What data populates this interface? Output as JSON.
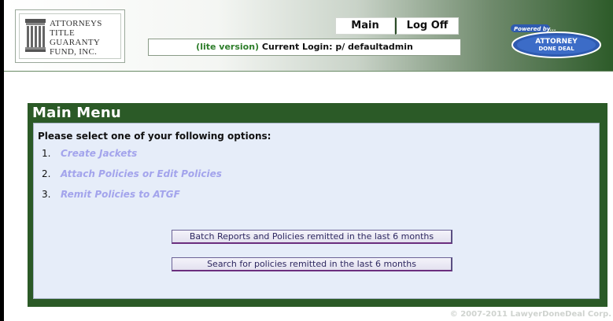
{
  "header": {
    "logo": {
      "lines": [
        "Attorneys",
        "Title",
        "Guaranty",
        "Fund, Inc."
      ]
    },
    "nav": {
      "main_label": "Main",
      "logoff_label": "Log Off"
    },
    "login": {
      "lite_label": "(lite version)",
      "current_login_text": "Current Login: p/ defaultadmin"
    },
    "powered_badge": {
      "top_text": "Powered by...",
      "brand_line1": "ATTORNEY",
      "brand_line2": "DONE DEAL"
    }
  },
  "main_menu": {
    "title": "Main Menu",
    "prompt": "Please select one of your following options:",
    "options": [
      {
        "number": "1.",
        "label": "Create Jackets"
      },
      {
        "number": "2.",
        "label": "Attach Policies or Edit Policies"
      },
      {
        "number": "3.",
        "label": "Remit Policies to ATGF"
      }
    ],
    "buttons": {
      "batch_reports": "Batch Reports and Policies remitted in the last 6 months",
      "search_policies": "Search for policies remitted in the last 6 months"
    }
  },
  "footer": {
    "copyright": "© 2007-2011 LawyerDoneDeal Corp."
  },
  "colors": {
    "panel_green": "#2b5a27",
    "panel_body": "#e6edf9",
    "option_link": "#a3a4ec",
    "lite_green": "#2d7d2a",
    "brand_blue": "#2f5bb0"
  }
}
